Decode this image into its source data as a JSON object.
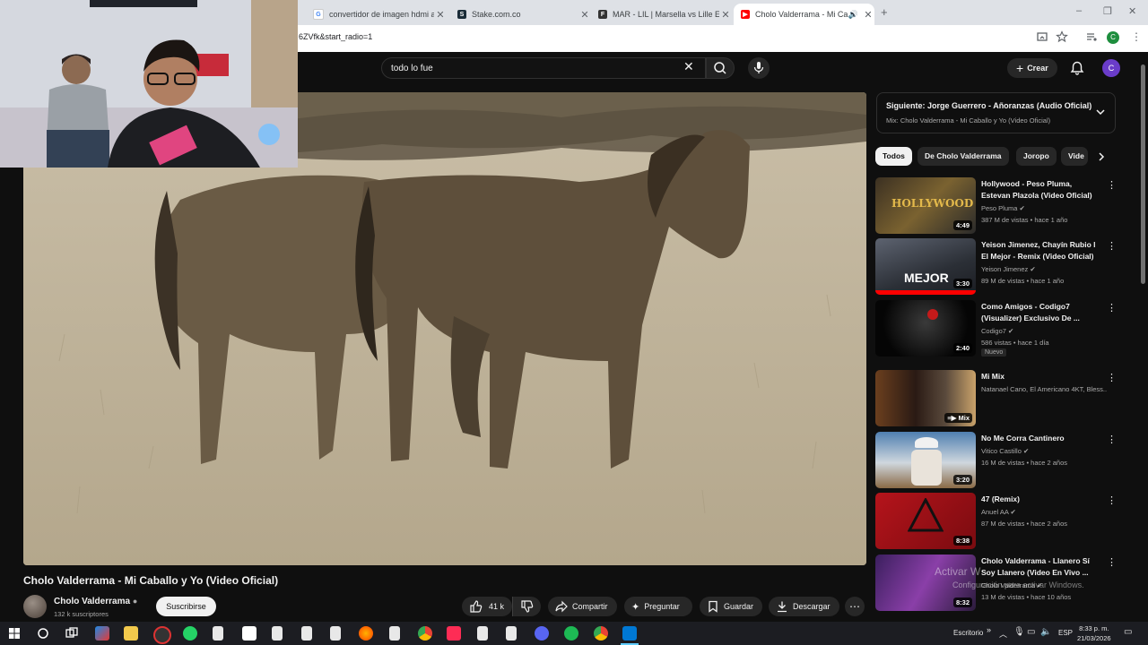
{
  "browser": {
    "tabs": [
      {
        "title": "convertidor de imagen hdmi a",
        "favicon": "google-icon"
      },
      {
        "title": "Stake.com.co",
        "favicon": "stake-icon"
      },
      {
        "title": "MAR - LIL | Marsella vs Lille EN",
        "favicon": "flashscore-icon"
      },
      {
        "title": "Cholo Valderrama - Mi Cab",
        "favicon": "youtube-icon",
        "active": true
      }
    ],
    "url": "6ZVfk&start_radio=1"
  },
  "header": {
    "search_value": "todo lo fue",
    "create_label": "Crear",
    "avatar_letter": "C"
  },
  "video": {
    "title": "Cholo Valderrama - Mi Caballo y Yo (Video Oficial)",
    "channel": "Cholo Valderrama",
    "subscribers": "132 k suscriptores",
    "subscribe_label": "Suscribirse",
    "likes": "41 k",
    "share_label": "Compartir",
    "ask_label": "Preguntar",
    "save_label": "Guardar",
    "download_label": "Descargar"
  },
  "up_next": {
    "title": "Siguiente: Jorge Guerrero - Añoranzas (Audio Oficial)",
    "subtitle": "Mix: Cholo Valderrama - Mi Caballo y Yo (Video Oficial)"
  },
  "chips": [
    "Todos",
    "De Cholo Valderrama",
    "Joropo",
    "Vide"
  ],
  "recommendations": [
    {
      "title": "Hollywood - Peso Pluma, Estevan Plazola (Video Oficial)",
      "channel": "Peso Pluma",
      "meta": "387 M de vistas • hace 1 año",
      "duration": "4:49",
      "verified": true
    },
    {
      "title": "Yeison Jimenez, Chayín Rubio l El Mejor - Remix (Video Oficial)",
      "channel": "Yeison Jimenez",
      "meta": "89 M de vistas • hace 1 año",
      "duration": "3:30",
      "verified": true
    },
    {
      "title": "Como Amigos - Codigo7 (Visualizer) Exclusivo De ...",
      "channel": "Codigo7",
      "meta": "586 vistas • hace 1 día",
      "duration": "2:40",
      "verified": true,
      "badge": "Nuevo"
    },
    {
      "title": "Mi Mix",
      "channel": "Natanael Cano, El Americano 4KT, Bless...",
      "meta": "",
      "duration": "Mix",
      "verified": false
    },
    {
      "title": "No Me Corra Cantinero",
      "channel": "Vitico Castillo",
      "meta": "16 M de vistas • hace 2 años",
      "duration": "3:20",
      "verified": true
    },
    {
      "title": "47 (Remix)",
      "channel": "Anuel AA",
      "meta": "87 M de vistas • hace 2 años",
      "duration": "8:38",
      "verified": true
    },
    {
      "title": "Cholo Valderrama - Llanero Sí Soy Llanero (Video En Vivo ...",
      "channel": "Cholo Valderrama",
      "meta": "13 M de vistas • hace 10 años",
      "duration": "8:32",
      "verified": true
    }
  ],
  "watermark": {
    "line1": "Activar W",
    "line2": "Configuración para activar Windows."
  },
  "taskbar": {
    "tray_label": "Escritorio",
    "language": "ESP",
    "time": "8:33 p. m.",
    "date": "21/03/2026"
  },
  "colors": {
    "youtube_bg": "#0f0f0f",
    "chip_selected": "#f1f1f1",
    "youtube_red": "#ff0000"
  }
}
